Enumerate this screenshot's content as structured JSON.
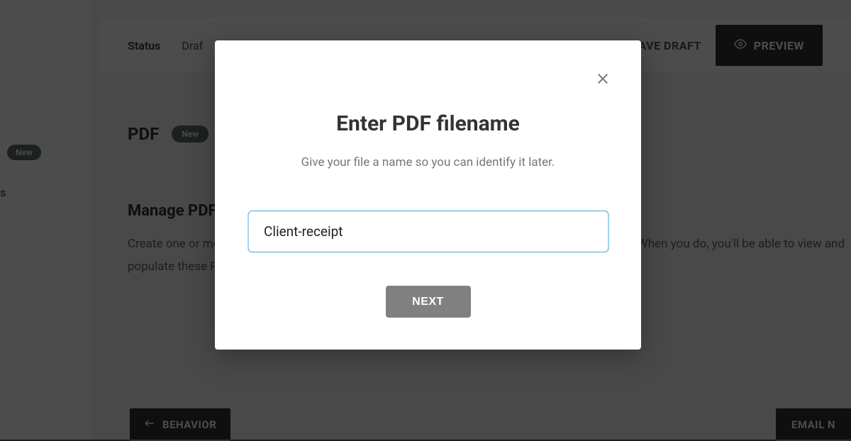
{
  "sidebar": {
    "badge_label": "New",
    "fragment_text": "s"
  },
  "header": {
    "status_label": "Status",
    "status_value": "Draf",
    "save_draft_label": "SAVE DRAFT",
    "preview_label": "PREVIEW"
  },
  "content": {
    "pdf_title": "PDF",
    "pdf_badge": "New",
    "manage_heading": "Manage PDF",
    "manage_desc": "Create one or more templates that will be automatically generated after each form submission. When you do, you'll be able to view and populate these PDFs alongside your form submissions."
  },
  "footer": {
    "behavior_label": "BEHAVIOR",
    "email_label": "EMAIL N"
  },
  "modal": {
    "title": "Enter PDF filename",
    "subtitle": "Give your file a name so you can identify it later.",
    "input_value": "Client-receipt",
    "next_label": "NEXT"
  }
}
